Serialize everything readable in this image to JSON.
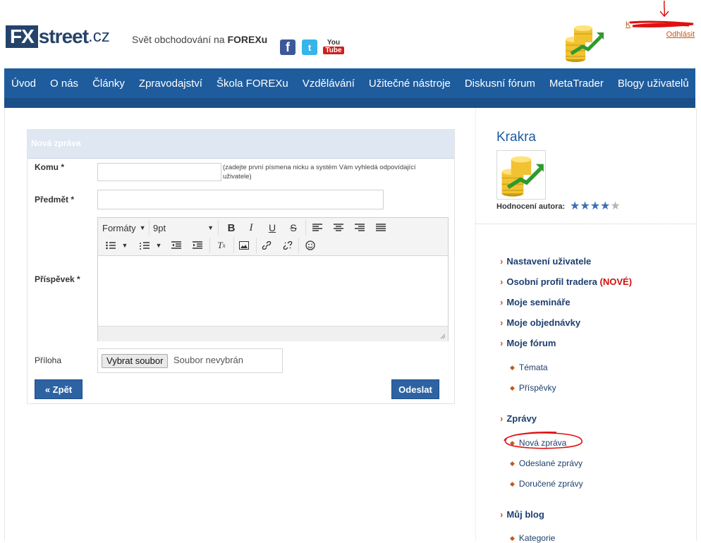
{
  "header": {
    "logo": {
      "fx": "FX",
      "street": "street",
      "cz": ".cz"
    },
    "tagline_prefix": "Svět obchodování na ",
    "tagline_bold": "FOREXu",
    "social": {
      "facebook": "f",
      "twitter": "t",
      "youtube_top": "You",
      "youtube_bottom": "Tube"
    },
    "top_links": {
      "username": "K",
      "logout": "Odhlásit"
    }
  },
  "nav": {
    "items": [
      "Úvod",
      "O nás",
      "Články",
      "Zpravodajství",
      "Škola FOREXu",
      "Vzdělávání",
      "Užitečné nástroje",
      "Diskusní fórum",
      "MetaTrader",
      "Blogy uživatelů"
    ]
  },
  "form": {
    "title": "Nová zpráva",
    "to_label": "Komu *",
    "to_value": "",
    "to_hint": "(zadejte první písmena nicku a systém Vám vyhledá odpovídající uživatele)",
    "subject_label": "Předmět *",
    "subject_value": "",
    "post_label": "Příspěvek *",
    "attachment_label": "Příloha",
    "file_button": "Vybrat soubor",
    "file_status": "Soubor nevybrán",
    "back_button": "« Zpět",
    "send_button": "Odeslat",
    "editor": {
      "formats_label": "Formáty",
      "font_size": "9pt",
      "bold": "B",
      "italic": "I",
      "underline": "U",
      "strike": "S"
    }
  },
  "sidebar": {
    "username": "Krakra",
    "rating_label": "Hodnocení autora:",
    "rating": {
      "value": 4,
      "max": 5
    },
    "menu": [
      {
        "label": "Nastavení uživatele"
      },
      {
        "label": "Osobní profil tradera",
        "badge": "(NOVÉ)"
      },
      {
        "label": "Moje semináře"
      },
      {
        "label": "Moje objednávky"
      },
      {
        "label": "Moje fórum"
      }
    ],
    "forum_sub": [
      "Témata",
      "Příspěvky"
    ],
    "messages_label": "Zprávy",
    "messages_sub": [
      "Nová zpráva",
      "Odeslané zprávy",
      "Doručené zprávy"
    ],
    "blog_label": "Můj blog",
    "blog_sub": [
      "Kategorie"
    ]
  },
  "colors": {
    "nav_blue": "#1e5c9e",
    "accent_orange": "#c05a1e",
    "button_blue": "#2d63a3",
    "annotation_red": "#e01010"
  }
}
